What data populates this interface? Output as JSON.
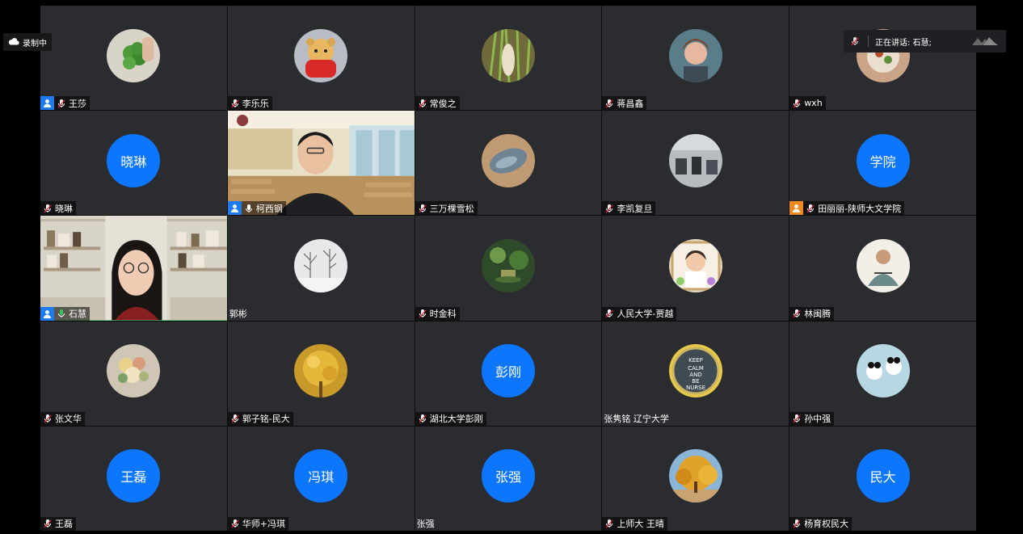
{
  "recording": {
    "label": "录制中",
    "icon": "cloud-icon"
  },
  "speaking": {
    "label": "正在讲话: 石慧;",
    "icon": "mic-icon"
  },
  "tiles": [
    {
      "name": "王莎",
      "host": "blue",
      "avatar_type": "photo",
      "avatar_theme": "clover"
    },
    {
      "name": "李乐乐",
      "avatar_type": "photo",
      "avatar_theme": "bear"
    },
    {
      "name": "常俊之",
      "avatar_type": "photo",
      "avatar_theme": "grass"
    },
    {
      "name": "蒋昌鑫",
      "avatar_type": "photo",
      "avatar_theme": "portrait"
    },
    {
      "name": "wxh",
      "avatar_type": "photo",
      "avatar_theme": "food"
    },
    {
      "name": "晓琳",
      "avatar_type": "text",
      "avatar_text": "晓琳"
    },
    {
      "name": "柯西钢",
      "host": "blue",
      "video": "classroom",
      "mic": "white"
    },
    {
      "name": "三万棵雪松",
      "avatar_type": "photo",
      "avatar_theme": "fish"
    },
    {
      "name": "李凯复旦",
      "avatar_type": "photo",
      "avatar_theme": "office"
    },
    {
      "name": "田丽丽-陕师大文学院",
      "host": "orange",
      "avatar_type": "text",
      "avatar_text": "学院"
    },
    {
      "name": "石慧",
      "host": "blue",
      "video": "bookshelf",
      "mic": "green",
      "active": true
    },
    {
      "name": "郭彬",
      "no_mic": true,
      "avatar_type": "photo",
      "avatar_theme": "snow"
    },
    {
      "name": "时金科",
      "avatar_type": "photo",
      "avatar_theme": "tea"
    },
    {
      "name": "人民大学-贾越",
      "avatar_type": "photo",
      "avatar_theme": "child"
    },
    {
      "name": "林闽腾",
      "avatar_type": "photo",
      "avatar_theme": "figure"
    },
    {
      "name": "张文华",
      "avatar_type": "photo",
      "avatar_theme": "flowers"
    },
    {
      "name": "郭子铭-民大",
      "avatar_type": "photo",
      "avatar_theme": "ginkgo"
    },
    {
      "name": "湖北大学彭刚",
      "avatar_type": "text",
      "avatar_text": "彭刚"
    },
    {
      "name": "张隽铭 辽宁大学",
      "no_mic": true,
      "avatar_type": "photo",
      "avatar_theme": "keepcalm",
      "avatar_words": [
        "KEEP",
        "CALM",
        "AND",
        "BE",
        "NURSE"
      ]
    },
    {
      "name": "孙中强",
      "avatar_type": "photo",
      "avatar_theme": "panda"
    },
    {
      "name": "王磊",
      "avatar_type": "text",
      "avatar_text": "王磊"
    },
    {
      "name": "华师+冯琪",
      "avatar_type": "text",
      "avatar_text": "冯琪"
    },
    {
      "name": "张强",
      "no_mic": true,
      "avatar_type": "text",
      "avatar_text": "张强"
    },
    {
      "name": "上师大 王晴",
      "avatar_type": "photo",
      "avatar_theme": "autumn"
    },
    {
      "name": "杨育权民大",
      "avatar_type": "text",
      "avatar_text": "民大"
    }
  ],
  "colors": {
    "accent": "#0c76ff",
    "tile_bg": "#2b2c2f",
    "muted_mic": "#ffffff",
    "active_mic": "#38c25a",
    "host_blue": "#1e7cf2",
    "host_orange": "#f08a1f"
  }
}
